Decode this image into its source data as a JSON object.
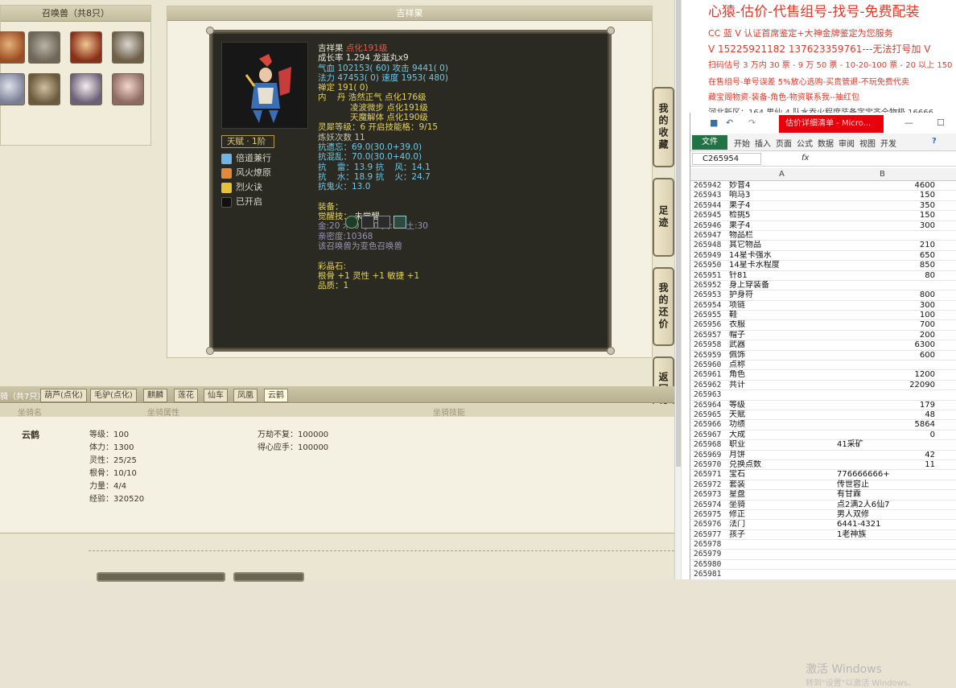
{
  "summon_panel": {
    "title": "召唤兽（共8只）"
  },
  "detail": {
    "title": "吉祥果",
    "stat_lines": [
      [
        {
          "t": "吉祥果 ",
          "c": "c-w"
        },
        {
          "t": "点化191级",
          "c": "c-r"
        }
      ],
      [
        {
          "t": "成长率 1.294 龙涎丸x9",
          "c": "c-w"
        }
      ],
      [
        {
          "t": "气血 102153( 60) 攻击 9441( 0)",
          "c": "c-c"
        }
      ],
      [
        {
          "t": "法力 47453( 0) 速度 1953( 480)",
          "c": "c-c"
        }
      ],
      [
        {
          "t": "禅定 191( 0)",
          "c": "c-y"
        }
      ],
      [
        {
          "t": "内    丹 浩然正气 点化176级",
          "c": "c-y"
        }
      ],
      [
        {
          "t": "            凌波微步 点化191级",
          "c": "c-y"
        }
      ],
      [
        {
          "t": "            天魔解体 点化190级",
          "c": "c-y"
        }
      ],
      [
        {
          "t": "灵犀等级：6 开启技能格：9/15",
          "c": "c-y"
        }
      ],
      [
        {
          "t": "炼妖次数 11",
          "c": "c-g"
        }
      ],
      [
        {
          "t": "抗遗忘：69.0(30.0+39.0)",
          "c": "c-c"
        }
      ],
      [
        {
          "t": "抗混乱：70.0(30.0+40.0)",
          "c": "c-c"
        }
      ],
      [
        {
          "t": "抗    雷：13.9 抗    风：14.1",
          "c": "c-c"
        }
      ],
      [
        {
          "t": "抗    水：18.9 抗    火：24.7",
          "c": "c-c"
        }
      ],
      [
        {
          "t": "抗鬼火：13.0",
          "c": "c-c"
        }
      ],
      [
        {
          "t": " ",
          "c": "c-w"
        }
      ],
      [
        {
          "t": "装备：",
          "c": "c-y"
        }
      ],
      [
        {
          "t": "觉醒技：",
          "c": "c-y"
        },
        {
          "t": " 未觉醒",
          "c": "c-w"
        }
      ],
      [
        {
          "t": "金:20 木:0 水:0 火:50 土:30",
          "c": "c-p"
        }
      ],
      [
        {
          "t": "亲密度:10368",
          "c": "c-p"
        }
      ],
      [
        {
          "t": "该召唤兽为变色召唤兽",
          "c": "c-p"
        }
      ],
      [
        {
          "t": " ",
          "c": "c-w"
        }
      ],
      [
        {
          "t": "彩晶石:",
          "c": "c-y"
        }
      ],
      [
        {
          "t": "根骨 +1 灵性 +1 敏捷 +1",
          "c": "c-y"
        }
      ],
      [
        {
          "t": "品质：1",
          "c": "c-y"
        }
      ]
    ],
    "tianfu": "天赋 · 1阶",
    "skills": [
      "倍道兼行",
      "风火燎原",
      "烈火诀",
      "已开启"
    ]
  },
  "side_tabs": [
    "我的收藏",
    "足迹",
    "我的还价",
    "返回顶部"
  ],
  "mounts": {
    "label": "骑（共7只）",
    "tabs": [
      "葫芦(点化)",
      "毛驴(点化)",
      "麒麟",
      "莲花",
      "仙车",
      "凤凰",
      "云鹤"
    ],
    "headers": [
      "坐骑名",
      "坐骑属性",
      "坐骑技能"
    ],
    "name": "云鹤",
    "attrs": [
      "等级：100",
      "体力：1300",
      "灵性：25/25",
      "根骨：10/10",
      "力量：4/4",
      "经验：320520"
    ],
    "skills": [
      "万劫不复：100000",
      "得心应手：100000"
    ]
  },
  "ad": {
    "headline": "心猿-估价-代售组号-找号-免费配装",
    "lines": [
      "CC 蓝 V 认证首席鉴定+大神金牌鉴定为您服务",
      "V 15225921182      137623359761---无法打号加 V",
      "扫码估号 3 万内 30 票 - 9 万 50 票 - 10-20-100 票 - 20 以上 150",
      "在售组号-单号误差 5%放心选购-买贵管退-不玩免费代卖",
      "藏宝阁物资-装备-角色-物资联系我--抽红包",
      "河北新区：164 男仙 4 队水吞火程度装备字宝齐全物极 16666"
    ]
  },
  "excel": {
    "title_box": "估价详细清单 - Micro...",
    "ribbon": [
      "文件",
      "开始",
      "插入",
      "页面",
      "公式",
      "数据",
      "审阅",
      "视图",
      "开发"
    ],
    "name_box": "C265954",
    "fx": "fx",
    "col_a": "A",
    "col_b": "B",
    "rows": [
      [
        "265942",
        "妙音4",
        "4600"
      ],
      [
        "265943",
        "响马3",
        "150"
      ],
      [
        "265944",
        "果子4",
        "350"
      ],
      [
        "265945",
        "检挑5",
        "150"
      ],
      [
        "265946",
        "果子4",
        "300"
      ],
      [
        "265947",
        "物品栏",
        ""
      ],
      [
        "265948",
        "其它物品",
        "210"
      ],
      [
        "265949",
        "14星卡强水",
        "650"
      ],
      [
        "265950",
        "14星卡水程度",
        "850"
      ],
      [
        "265951",
        "针81",
        "80"
      ],
      [
        "265952",
        "身上穿装备",
        ""
      ],
      [
        "265953",
        "护身符",
        "800"
      ],
      [
        "265954",
        "项链",
        "300"
      ],
      [
        "265955",
        "鞋",
        "100"
      ],
      [
        "265956",
        "衣服",
        "700"
      ],
      [
        "265957",
        "帽子",
        "200"
      ],
      [
        "265958",
        "武器",
        "6300"
      ],
      [
        "265959",
        "佩饰",
        "600"
      ],
      [
        "265960",
        "点称",
        ""
      ],
      [
        "265961",
        "角色",
        "1200"
      ],
      [
        "265962",
        "共计",
        "22090"
      ],
      [
        "265963",
        "",
        ""
      ],
      [
        "265964",
        "等级",
        "179"
      ],
      [
        "265965",
        "天赋",
        "48"
      ],
      [
        "265966",
        "功绩",
        "5864"
      ],
      [
        "265967",
        "大成",
        "0"
      ],
      [
        "265968",
        "职业",
        "41采矿"
      ],
      [
        "265969",
        "月饼",
        "42"
      ],
      [
        "265970",
        "兑换点数",
        "11"
      ],
      [
        "265971",
        "宝石",
        "776666666+"
      ],
      [
        "265972",
        "套装",
        "传世容止"
      ],
      [
        "265973",
        "星盘",
        "有甘霖"
      ],
      [
        "265974",
        "坐骑",
        "点2满2人6仙7"
      ],
      [
        "265975",
        "修正",
        "男人双修"
      ],
      [
        "265976",
        "法门",
        "6441-4321"
      ],
      [
        "265977",
        "孩子",
        "1老神族"
      ],
      [
        "265978",
        "",
        ""
      ],
      [
        "265979",
        "",
        ""
      ],
      [
        "265980",
        "",
        ""
      ],
      [
        "265981",
        "",
        ""
      ]
    ],
    "text_rows": [
      "265968",
      "265971",
      "265972",
      "265973",
      "265974",
      "265975",
      "265976",
      "265977"
    ]
  },
  "watermark": {
    "line1": "激活 Windows",
    "line2": "转到\"设置\"以激活 Windows。"
  }
}
